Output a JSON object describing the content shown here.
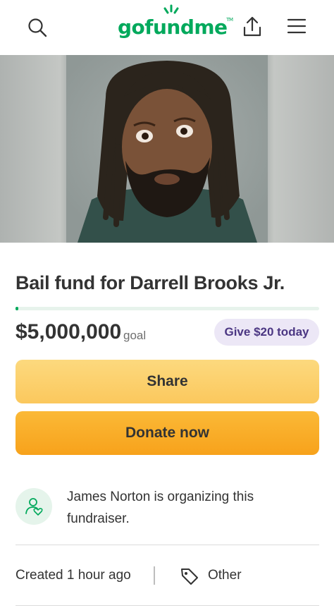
{
  "header": {
    "logo_text": "gofundme",
    "logo_tm": "TM",
    "icons": [
      "search-icon",
      "share-upload-icon",
      "menu-icon"
    ]
  },
  "campaign": {
    "title": "Bail fund for Darrell Brooks Jr.",
    "amount": "$5,000,000",
    "goal_label": "goal",
    "progress_fraction": 0.01,
    "give_label": "Give $20 today",
    "share_label": "Share",
    "donate_label": "Donate now"
  },
  "organizer": {
    "text": "James Norton is organizing this fundraiser."
  },
  "meta": {
    "created": "Created 1 hour ago",
    "category": "Other"
  },
  "colors": {
    "brand_green": "#02a95c",
    "share_yellow": "#fbc85d",
    "donate_orange": "#f7a21b",
    "give_pill_bg": "#ece7f6",
    "give_pill_text": "#4b3683"
  }
}
